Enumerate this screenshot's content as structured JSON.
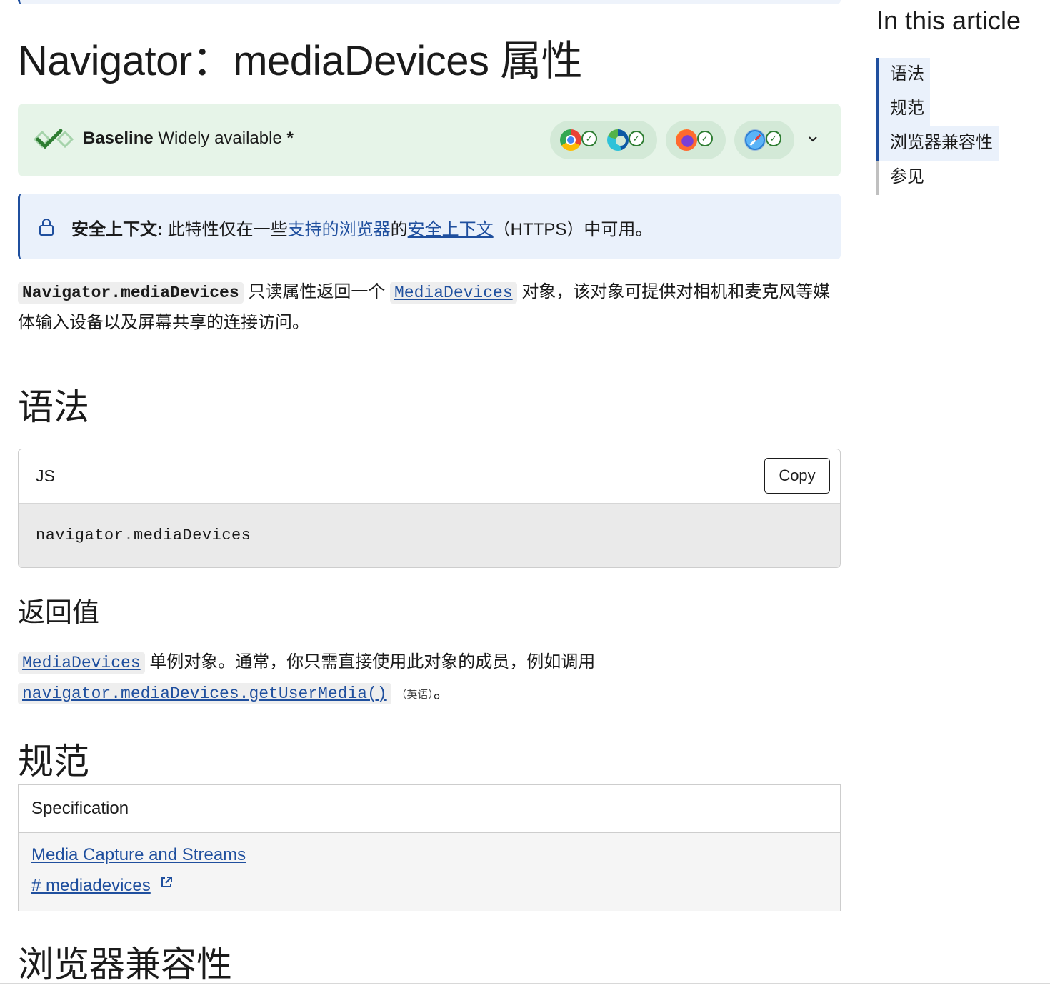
{
  "title": "Navigator：mediaDevices 属性",
  "baseline": {
    "label_bold": "Baseline",
    "label_rest": "Widely available",
    "asterisk": "*",
    "browsers": [
      "chrome",
      "edge",
      "firefox",
      "safari"
    ],
    "accent": "#2e7d32"
  },
  "secure_note": {
    "label": "安全上下文:",
    "text_before": "此特性仅在一些",
    "link1": "支持的浏览器",
    "text_mid": "的",
    "link2": "安全上下文",
    "text_after": "（HTTPS）中可用。"
  },
  "intro": {
    "code": "Navigator.mediaDevices",
    "text1": "只读属性返回一个",
    "link_code": "MediaDevices",
    "text2": "对象，该对象可提供对相机和麦克风等媒体输入设备以及屏幕共享的连接访问。"
  },
  "syntax": {
    "heading": "语法",
    "lang": "JS",
    "copy_label": "Copy",
    "code_part1": "navigator",
    "code_part2": ".",
    "code_part3": "mediaDevices"
  },
  "return_value": {
    "heading": "返回值",
    "link_code": "MediaDevices",
    "text1": "单例对象。通常，你只需直接使用此对象的成员，例如调用",
    "link_code2": "navigator.mediaDevices.getUserMedia()",
    "en_note": "（英语）",
    "end": "。"
  },
  "spec": {
    "heading": "规范",
    "column": "Specification",
    "link_title": "Media Capture and Streams",
    "link_anchor": "# mediadevices"
  },
  "compat": {
    "heading": "浏览器兼容性"
  },
  "toc": {
    "title": "In this article",
    "items": [
      {
        "label": "语法"
      },
      {
        "label": "规范"
      },
      {
        "label": "浏览器兼容性"
      },
      {
        "label": "参见"
      }
    ]
  },
  "colors": {
    "link": "#1f4f9e",
    "baseline_bg": "#e6f4e8",
    "note_bg": "#eaf1fb"
  }
}
